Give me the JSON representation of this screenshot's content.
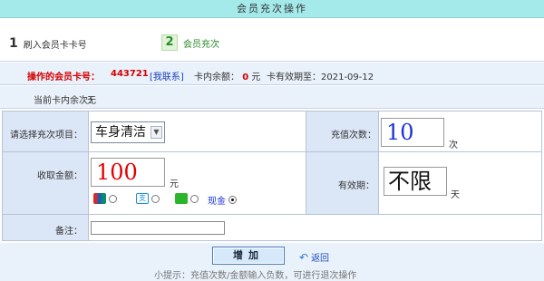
{
  "title": "会员充次操作",
  "steps": [
    {
      "num": "1",
      "label": "刷入会员卡卡号"
    },
    {
      "num": "2",
      "label": "会员充次"
    }
  ],
  "card": {
    "label": "操作的会员卡号：",
    "number": "443721",
    "contact": "[我联系]",
    "balance_label": "卡内余额：",
    "balance_value": "0",
    "balance_unit": "元",
    "expiry": "卡有效期至：2021-09-12"
  },
  "current_times": {
    "label": "当前卡内余次：",
    "value": "无"
  },
  "form": {
    "item_label": "请选择充次项目：",
    "item_value": "车身清洁",
    "times_label": "充值次数：",
    "times_value": "10",
    "times_unit": "次",
    "amount_label": "收取金额：",
    "amount_value": "100",
    "amount_unit": "元",
    "validity_label": "有效期：",
    "validity_value": "不限",
    "validity_unit": "天",
    "cash_label": "现金",
    "note_label": "备注："
  },
  "icons": {
    "unionpay": "unionpay-icon",
    "alipay": "alipay-icon",
    "wechat": "wechat-icon"
  },
  "colors": {
    "header_bg": "#a5eaea",
    "label_bg": "#dbe6f6",
    "accent_red": "#d40000",
    "accent_blue": "#1a32d9"
  },
  "footer": {
    "add_label": "增加",
    "back_label": "返回",
    "tip": "小提示：充值次数/金额输入负数，可进行退次操作"
  }
}
